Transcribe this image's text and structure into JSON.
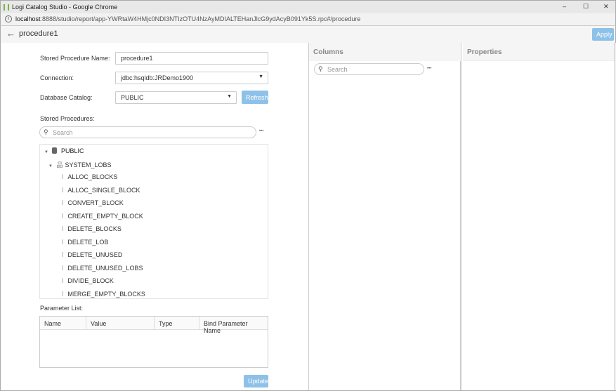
{
  "window": {
    "title": "Logi Catalog Studio - Google Chrome",
    "minimize": "–",
    "maximize": "☐",
    "close": "✕"
  },
  "url": {
    "host": "localhost",
    "rest": ":8888/studio/report/app-YWRtaW4HMjc0NDI3NTIzOTU4NzAyMDIALTEHanJlcG9ydAcyB091Yk5S.rpc#/procedure"
  },
  "header": {
    "title": "procedure1",
    "apply": "Apply"
  },
  "form": {
    "name_label": "Stored Procedure Name:",
    "name_value": "procedure1",
    "connection_label": "Connection:",
    "connection_value": "jdbc:hsqldb:JRDemo1900",
    "catalog_label": "Database Catalog:",
    "catalog_value": "PUBLIC",
    "refresh": "Refresh",
    "procedures_label": "Stored Procedures:",
    "search_placeholder": "Search",
    "more": "•••"
  },
  "tree": {
    "catalog": "PUBLIC",
    "schema": "SYSTEM_LOBS",
    "procedures": [
      "ALLOC_BLOCKS",
      "ALLOC_SINGLE_BLOCK",
      "CONVERT_BLOCK",
      "CREATE_EMPTY_BLOCK",
      "DELETE_BLOCKS",
      "DELETE_LOB",
      "DELETE_UNUSED",
      "DELETE_UNUSED_LOBS",
      "DIVIDE_BLOCK",
      "MERGE_EMPTY_BLOCKS"
    ]
  },
  "params": {
    "label": "Parameter List:",
    "columns": [
      "Name",
      "Value",
      "Type",
      "Bind Parameter Name"
    ],
    "update": "Update"
  },
  "columns_panel": {
    "title": "Columns",
    "search_placeholder": "Search",
    "more": "•••"
  },
  "properties_panel": {
    "title": "Properties"
  }
}
